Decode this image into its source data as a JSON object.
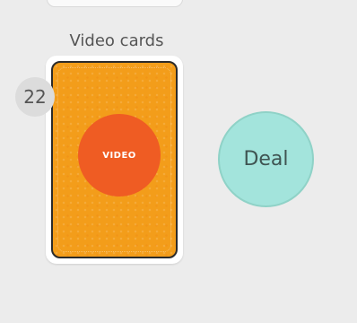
{
  "pile": {
    "title": "Video cards",
    "count": "22",
    "card_label": "VIDEO"
  },
  "actions": {
    "deal_label": "Deal"
  },
  "colors": {
    "background": "#ececec",
    "card_orange": "#f39d1a",
    "disc_red_orange": "#ef5c23",
    "deal_teal": "#a3e4dc"
  }
}
